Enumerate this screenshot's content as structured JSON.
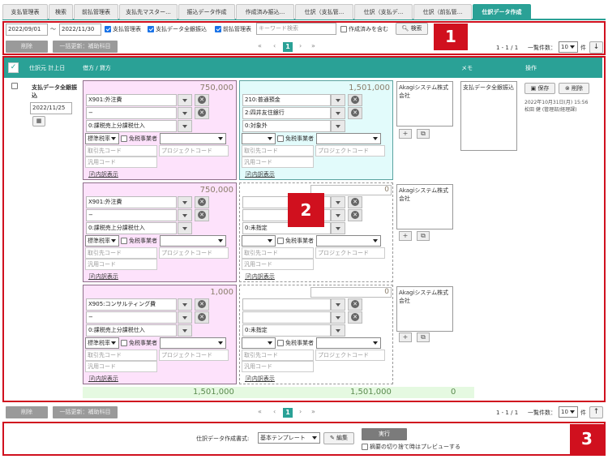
{
  "tabs": [
    {
      "label": "支払管理表"
    },
    {
      "label": "検索"
    },
    {
      "label": "前払管理表"
    },
    {
      "label": "支払先マスター..."
    },
    {
      "label": "振込データ作成"
    },
    {
      "label": "作成済み振込..."
    },
    {
      "label": "仕訳（支払管..."
    },
    {
      "label": "仕訳（支払デ..."
    },
    {
      "label": "仕訳（前払管..."
    },
    {
      "label": "仕訳データ作成"
    }
  ],
  "filters": {
    "date_from": "2022/09/01",
    "tilde": "〜",
    "date_to": "2022/11/30",
    "opt1": "支払管理表",
    "opt2": "支払データ全銀振込",
    "opt3": "前払管理表",
    "keyword_placeholder": "キーワード検索",
    "include_created": "作成済みを含む",
    "search_button": "検索"
  },
  "toolbar": {
    "delete": "削除",
    "bulk_update": "一括更新：補助科目",
    "paging_info": "1 - 1 / 1",
    "page_size_label": "一覧件数：",
    "page_size": "10",
    "page_unit": "件",
    "page": "1",
    "first": "«",
    "prev": "‹",
    "next": "›",
    "last": "»"
  },
  "header": {
    "check": "✓",
    "date": "仕訳元 計上日",
    "debit_credit": "借方 / 貸方",
    "memo": "メモ",
    "actions": "操作"
  },
  "row": {
    "source": "支払データ全銀振込",
    "date": "2022/11/25",
    "memo": "支払データ全銀振込",
    "save": "保存",
    "delete": "削除",
    "timestamp": "2022年10月31日(月) 15:56",
    "user": "松田 健 (管理部/経理課)"
  },
  "labels": {
    "tax_rate": "標準税率",
    "exempt": "免税事業者",
    "partner_code": "取引先コード",
    "project_code": "プロジェクトコード",
    "generic_code": "汎用コード",
    "detail": "内訳表示"
  },
  "entries": [
    {
      "debit": {
        "amount": "750,000",
        "account": "X901:外注費",
        "sub": "−",
        "tax": "0:課税売上分課税仕入"
      },
      "credit": {
        "amount": "1,501,000",
        "account": "210:普通預金",
        "sub": "2:四井友住銀行",
        "tax": "0:対象外"
      },
      "note": "Akagiシステム株式会社"
    },
    {
      "debit": {
        "amount": "750,000",
        "account": "X901:外注費",
        "sub": "−",
        "tax": "0:課税売上分課税仕入"
      },
      "credit": {
        "amount": "0",
        "account": "",
        "sub": "",
        "tax": "0:未指定"
      },
      "note": "Akagiシステム株式会社"
    },
    {
      "debit": {
        "amount": "1,000",
        "account": "X905:コンサルティング費",
        "sub": "−",
        "tax": "0:課税売上分課税仕入"
      },
      "credit": {
        "amount": "0",
        "account": "",
        "sub": "",
        "tax": "0:未指定"
      },
      "note": "Akagiシステム株式会社"
    }
  ],
  "totals": {
    "debit": "1,501,000",
    "credit": "1,501,000",
    "diff": "0"
  },
  "bottom": {
    "format_label": "仕訳データ作成書式:",
    "template": "基本テンプレート",
    "edit": "編集",
    "run": "実行",
    "preview": "摘要の切り捨て時はプレビューする"
  },
  "badges": {
    "b1": "1",
    "b2": "2",
    "b3": "3"
  },
  "colors": {
    "accent": "#2aa196",
    "highlight": "#d0101e",
    "debit_bg": "#fde2fb",
    "credit_bg": "#e2fbfb"
  }
}
